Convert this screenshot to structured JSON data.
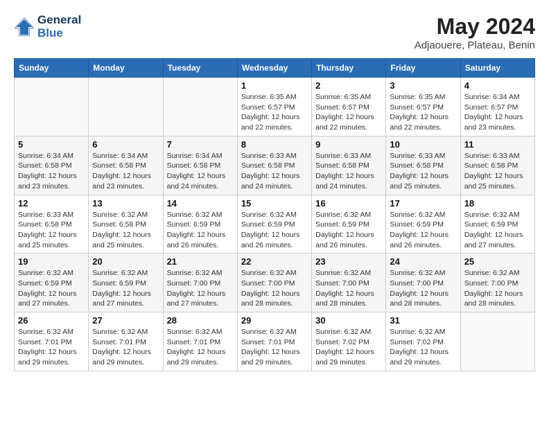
{
  "header": {
    "logo_line1": "General",
    "logo_line2": "Blue",
    "month_year": "May 2024",
    "location": "Adjaouere, Plateau, Benin"
  },
  "weekdays": [
    "Sunday",
    "Monday",
    "Tuesday",
    "Wednesday",
    "Thursday",
    "Friday",
    "Saturday"
  ],
  "weeks": [
    [
      {
        "day": "",
        "sunrise": "",
        "sunset": "",
        "daylight": ""
      },
      {
        "day": "",
        "sunrise": "",
        "sunset": "",
        "daylight": ""
      },
      {
        "day": "",
        "sunrise": "",
        "sunset": "",
        "daylight": ""
      },
      {
        "day": "1",
        "sunrise": "Sunrise: 6:35 AM",
        "sunset": "Sunset: 6:57 PM",
        "daylight": "Daylight: 12 hours and 22 minutes."
      },
      {
        "day": "2",
        "sunrise": "Sunrise: 6:35 AM",
        "sunset": "Sunset: 6:57 PM",
        "daylight": "Daylight: 12 hours and 22 minutes."
      },
      {
        "day": "3",
        "sunrise": "Sunrise: 6:35 AM",
        "sunset": "Sunset: 6:57 PM",
        "daylight": "Daylight: 12 hours and 22 minutes."
      },
      {
        "day": "4",
        "sunrise": "Sunrise: 6:34 AM",
        "sunset": "Sunset: 6:57 PM",
        "daylight": "Daylight: 12 hours and 23 minutes."
      }
    ],
    [
      {
        "day": "5",
        "sunrise": "Sunrise: 6:34 AM",
        "sunset": "Sunset: 6:58 PM",
        "daylight": "Daylight: 12 hours and 23 minutes."
      },
      {
        "day": "6",
        "sunrise": "Sunrise: 6:34 AM",
        "sunset": "Sunset: 6:58 PM",
        "daylight": "Daylight: 12 hours and 23 minutes."
      },
      {
        "day": "7",
        "sunrise": "Sunrise: 6:34 AM",
        "sunset": "Sunset: 6:58 PM",
        "daylight": "Daylight: 12 hours and 24 minutes."
      },
      {
        "day": "8",
        "sunrise": "Sunrise: 6:33 AM",
        "sunset": "Sunset: 6:58 PM",
        "daylight": "Daylight: 12 hours and 24 minutes."
      },
      {
        "day": "9",
        "sunrise": "Sunrise: 6:33 AM",
        "sunset": "Sunset: 6:58 PM",
        "daylight": "Daylight: 12 hours and 24 minutes."
      },
      {
        "day": "10",
        "sunrise": "Sunrise: 6:33 AM",
        "sunset": "Sunset: 6:58 PM",
        "daylight": "Daylight: 12 hours and 25 minutes."
      },
      {
        "day": "11",
        "sunrise": "Sunrise: 6:33 AM",
        "sunset": "Sunset: 6:58 PM",
        "daylight": "Daylight: 12 hours and 25 minutes."
      }
    ],
    [
      {
        "day": "12",
        "sunrise": "Sunrise: 6:33 AM",
        "sunset": "Sunset: 6:58 PM",
        "daylight": "Daylight: 12 hours and 25 minutes."
      },
      {
        "day": "13",
        "sunrise": "Sunrise: 6:32 AM",
        "sunset": "Sunset: 6:58 PM",
        "daylight": "Daylight: 12 hours and 25 minutes."
      },
      {
        "day": "14",
        "sunrise": "Sunrise: 6:32 AM",
        "sunset": "Sunset: 6:59 PM",
        "daylight": "Daylight: 12 hours and 26 minutes."
      },
      {
        "day": "15",
        "sunrise": "Sunrise: 6:32 AM",
        "sunset": "Sunset: 6:59 PM",
        "daylight": "Daylight: 12 hours and 26 minutes."
      },
      {
        "day": "16",
        "sunrise": "Sunrise: 6:32 AM",
        "sunset": "Sunset: 6:59 PM",
        "daylight": "Daylight: 12 hours and 26 minutes."
      },
      {
        "day": "17",
        "sunrise": "Sunrise: 6:32 AM",
        "sunset": "Sunset: 6:59 PM",
        "daylight": "Daylight: 12 hours and 26 minutes."
      },
      {
        "day": "18",
        "sunrise": "Sunrise: 6:32 AM",
        "sunset": "Sunset: 6:59 PM",
        "daylight": "Daylight: 12 hours and 27 minutes."
      }
    ],
    [
      {
        "day": "19",
        "sunrise": "Sunrise: 6:32 AM",
        "sunset": "Sunset: 6:59 PM",
        "daylight": "Daylight: 12 hours and 27 minutes."
      },
      {
        "day": "20",
        "sunrise": "Sunrise: 6:32 AM",
        "sunset": "Sunset: 6:59 PM",
        "daylight": "Daylight: 12 hours and 27 minutes."
      },
      {
        "day": "21",
        "sunrise": "Sunrise: 6:32 AM",
        "sunset": "Sunset: 7:00 PM",
        "daylight": "Daylight: 12 hours and 27 minutes."
      },
      {
        "day": "22",
        "sunrise": "Sunrise: 6:32 AM",
        "sunset": "Sunset: 7:00 PM",
        "daylight": "Daylight: 12 hours and 28 minutes."
      },
      {
        "day": "23",
        "sunrise": "Sunrise: 6:32 AM",
        "sunset": "Sunset: 7:00 PM",
        "daylight": "Daylight: 12 hours and 28 minutes."
      },
      {
        "day": "24",
        "sunrise": "Sunrise: 6:32 AM",
        "sunset": "Sunset: 7:00 PM",
        "daylight": "Daylight: 12 hours and 28 minutes."
      },
      {
        "day": "25",
        "sunrise": "Sunrise: 6:32 AM",
        "sunset": "Sunset: 7:00 PM",
        "daylight": "Daylight: 12 hours and 28 minutes."
      }
    ],
    [
      {
        "day": "26",
        "sunrise": "Sunrise: 6:32 AM",
        "sunset": "Sunset: 7:01 PM",
        "daylight": "Daylight: 12 hours and 29 minutes."
      },
      {
        "day": "27",
        "sunrise": "Sunrise: 6:32 AM",
        "sunset": "Sunset: 7:01 PM",
        "daylight": "Daylight: 12 hours and 29 minutes."
      },
      {
        "day": "28",
        "sunrise": "Sunrise: 6:32 AM",
        "sunset": "Sunset: 7:01 PM",
        "daylight": "Daylight: 12 hours and 29 minutes."
      },
      {
        "day": "29",
        "sunrise": "Sunrise: 6:32 AM",
        "sunset": "Sunset: 7:01 PM",
        "daylight": "Daylight: 12 hours and 29 minutes."
      },
      {
        "day": "30",
        "sunrise": "Sunrise: 6:32 AM",
        "sunset": "Sunset: 7:02 PM",
        "daylight": "Daylight: 12 hours and 29 minutes."
      },
      {
        "day": "31",
        "sunrise": "Sunrise: 6:32 AM",
        "sunset": "Sunset: 7:02 PM",
        "daylight": "Daylight: 12 hours and 29 minutes."
      },
      {
        "day": "",
        "sunrise": "",
        "sunset": "",
        "daylight": ""
      }
    ]
  ]
}
